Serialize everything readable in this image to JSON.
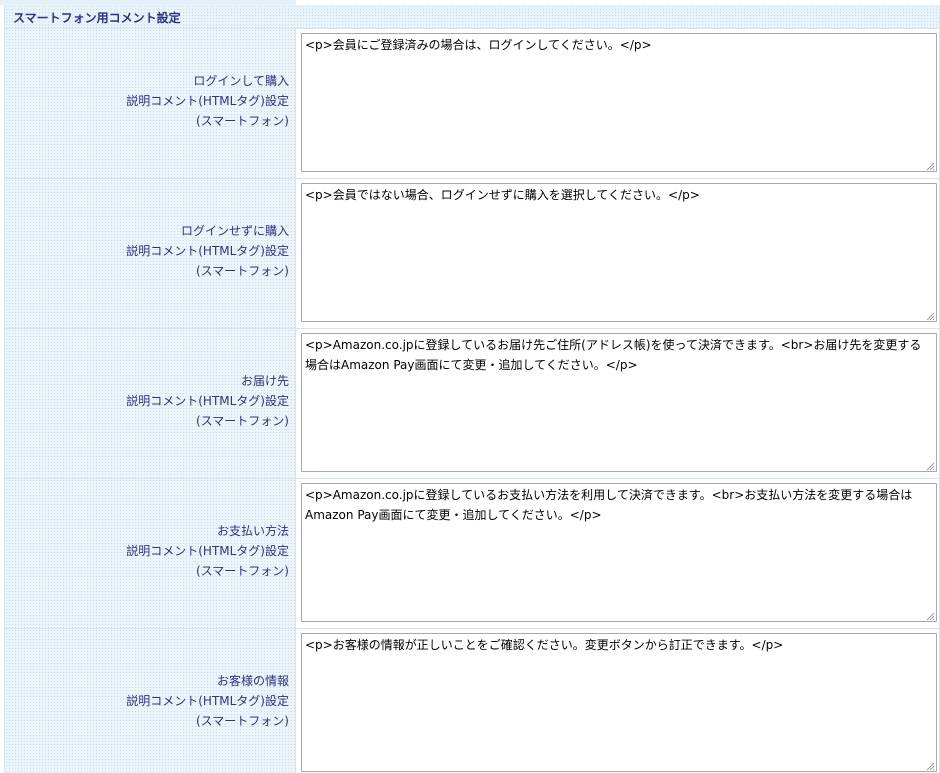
{
  "section": {
    "title": "スマートフォン用コメント設定"
  },
  "rows": [
    {
      "label_line1": "ログインして購入",
      "label_line2": "説明コメント(HTMLタグ)設定",
      "label_line3": "(スマートフォン)",
      "value": "<p>会員にご登録済みの場合は、ログインしてください。</p>"
    },
    {
      "label_line1": "ログインせずに購入",
      "label_line2": "説明コメント(HTMLタグ)設定",
      "label_line3": "(スマートフォン)",
      "value": "<p>会員ではない場合、ログインせずに購入を選択してください。</p>"
    },
    {
      "label_line1": "お届け先",
      "label_line2": "説明コメント(HTMLタグ)設定",
      "label_line3": "(スマートフォン)",
      "value": "<p>Amazon.co.jpに登録しているお届け先ご住所(アドレス帳)を使って決済できます。<br>お届け先を変更する場合はAmazon Pay画面にて変更・追加してください。</p>"
    },
    {
      "label_line1": "お支払い方法",
      "label_line2": "説明コメント(HTMLタグ)設定",
      "label_line3": "(スマートフォン)",
      "value": "<p>Amazon.co.jpに登録しているお支払い方法を利用して決済できます。<br>お支払い方法を変更する場合はAmazon Pay画面にて変更・追加してください。</p>"
    },
    {
      "label_line1": "お客様の情報",
      "label_line2": "説明コメント(HTMLタグ)設定",
      "label_line3": "(スマートフォン)",
      "value": "<p>お客様の情報が正しいことをご確認ください。変更ボタンから訂正できます。</p>"
    }
  ]
}
